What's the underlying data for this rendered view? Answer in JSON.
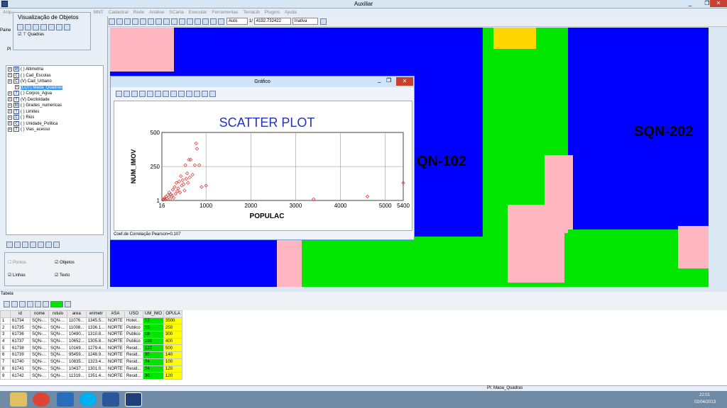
{
  "app": {
    "title": "Auxiliar"
  },
  "menu": [
    "Arqu",
    "MNT",
    "Cadastral",
    "Rede",
    "Análise",
    "SCarta",
    "Executar",
    "Ferramentas",
    "TerraLib",
    "Plugins",
    "Ajuda"
  ],
  "toolbar": {
    "scale_mode": "Auto",
    "scale_prefix": "1/",
    "scale_value": "4192.732422",
    "state": "Inativa"
  },
  "object_view": {
    "title": "Visualização de Objetos",
    "panel_label": "Paine",
    "item": "Quadras"
  },
  "tree": {
    "pl_label": "Pl",
    "items": [
      {
        "tag": "M",
        "label": "( ) Altimetria"
      },
      {
        "tag": "C",
        "label": "( ) Cad_Escolas"
      },
      {
        "tag": "C",
        "label": "(V) Cad_Urbano"
      },
      {
        "tag": "",
        "label": "(LOT) Maoa_Quadras",
        "selected": true
      },
      {
        "tag": "T",
        "label": "( ) Corpos_Agua"
      },
      {
        "tag": "T",
        "label": "(V) Declividade"
      },
      {
        "tag": "M",
        "label": "( ) Grades_numericas"
      },
      {
        "tag": "T",
        "label": "( ) Limites"
      },
      {
        "tag": "C",
        "label": "( ) Rios"
      },
      {
        "tag": "C",
        "label": "( ) Unidade_Politica"
      },
      {
        "tag": "T",
        "label": "( ) Vias_acesso"
      }
    ]
  },
  "options": {
    "pontos": "Pontos",
    "objetos": "Objetos",
    "linhas": "Linhas",
    "texto": "Texto"
  },
  "map": {
    "labels": [
      "QN-102",
      "SQN-202"
    ]
  },
  "chart_window": {
    "title": "Gráfico",
    "status": "Coef.de Correlação Pearson=0.107"
  },
  "chart_data": {
    "type": "scatter",
    "title": "SCATTER PLOT",
    "xlabel": "POPULAC",
    "ylabel": "NUM_IMOV",
    "xlim": [
      16,
      5400
    ],
    "ylim": [
      1,
      500
    ],
    "xticks": [
      "16",
      "1000",
      "2000",
      "3000",
      "4000",
      "5000",
      "5400"
    ],
    "yticks": [
      "500",
      "250",
      "1"
    ],
    "grid": true,
    "point_color": "#e03030",
    "points": [
      [
        40,
        5
      ],
      [
        60,
        10
      ],
      [
        80,
        20
      ],
      [
        90,
        8
      ],
      [
        110,
        30
      ],
      [
        130,
        15
      ],
      [
        150,
        40
      ],
      [
        170,
        25
      ],
      [
        180,
        60
      ],
      [
        200,
        12
      ],
      [
        220,
        45
      ],
      [
        240,
        35
      ],
      [
        260,
        80
      ],
      [
        280,
        20
      ],
      [
        300,
        100
      ],
      [
        320,
        50
      ],
      [
        340,
        130
      ],
      [
        360,
        70
      ],
      [
        380,
        90
      ],
      [
        400,
        140
      ],
      [
        420,
        60
      ],
      [
        440,
        180
      ],
      [
        460,
        110
      ],
      [
        480,
        150
      ],
      [
        500,
        120
      ],
      [
        520,
        75
      ],
      [
        540,
        260
      ],
      [
        560,
        160
      ],
      [
        580,
        200
      ],
      [
        600,
        130
      ],
      [
        620,
        300
      ],
      [
        640,
        170
      ],
      [
        660,
        300
      ],
      [
        700,
        190
      ],
      [
        750,
        260
      ],
      [
        780,
        420
      ],
      [
        800,
        380
      ],
      [
        850,
        260
      ],
      [
        900,
        100
      ],
      [
        1000,
        110
      ],
      [
        3400,
        10
      ],
      [
        4600,
        30
      ],
      [
        5400,
        130
      ]
    ]
  },
  "table": {
    "title": "Tabela",
    "columns": [
      "",
      "id",
      "nome",
      "rotulo",
      "area",
      "erimetr",
      "ASA",
      "USO",
      "UM_IMO",
      "OPULA"
    ],
    "rows": [
      [
        "1",
        "61734",
        "SQN-...",
        "SQN-...",
        "11076...",
        "1345.5...",
        "NORTE",
        "Hotel...",
        "12",
        "3500"
      ],
      [
        "2",
        "61735",
        "SQN-...",
        "SQN-...",
        "11008...",
        "1336.1...",
        "NORTE",
        "Publico",
        "15",
        "250"
      ],
      [
        "3",
        "61736",
        "SQN-...",
        "SQN-...",
        "10490...",
        "1310.8...",
        "NORTE",
        "Publico",
        "18",
        "300"
      ],
      [
        "4",
        "61737",
        "SQN-...",
        "SQN-...",
        "10652...",
        "1305.8...",
        "NORTE",
        "Publico",
        "100",
        "400"
      ],
      [
        "5",
        "61738",
        "SQN-...",
        "SQN-...",
        "10169...",
        "1279.4...",
        "NORTE",
        "Resid...",
        "120",
        "500"
      ],
      [
        "6",
        "61739",
        "SQN-...",
        "SQN-...",
        "95459...",
        "1248.9...",
        "NORTE",
        "Resid...",
        "35",
        "140"
      ],
      [
        "7",
        "61740",
        "SQN-...",
        "SQN-...",
        "10835...",
        "1323.4...",
        "NORTE",
        "Resid...",
        "24",
        "100"
      ],
      [
        "8",
        "61741",
        "SQN-...",
        "SQN-...",
        "10437...",
        "1301.0...",
        "NORTE",
        "Resid...",
        "24",
        "120"
      ],
      [
        "9",
        "61742",
        "SQN-...",
        "SQN-...",
        "11319...",
        "1351.4...",
        "NORTE",
        "Resid...",
        "30",
        "120"
      ]
    ]
  },
  "status": {
    "layer": "PI: Maoa_Quadras"
  },
  "clock": {
    "time": "22:01",
    "date": "02/04/2013"
  }
}
